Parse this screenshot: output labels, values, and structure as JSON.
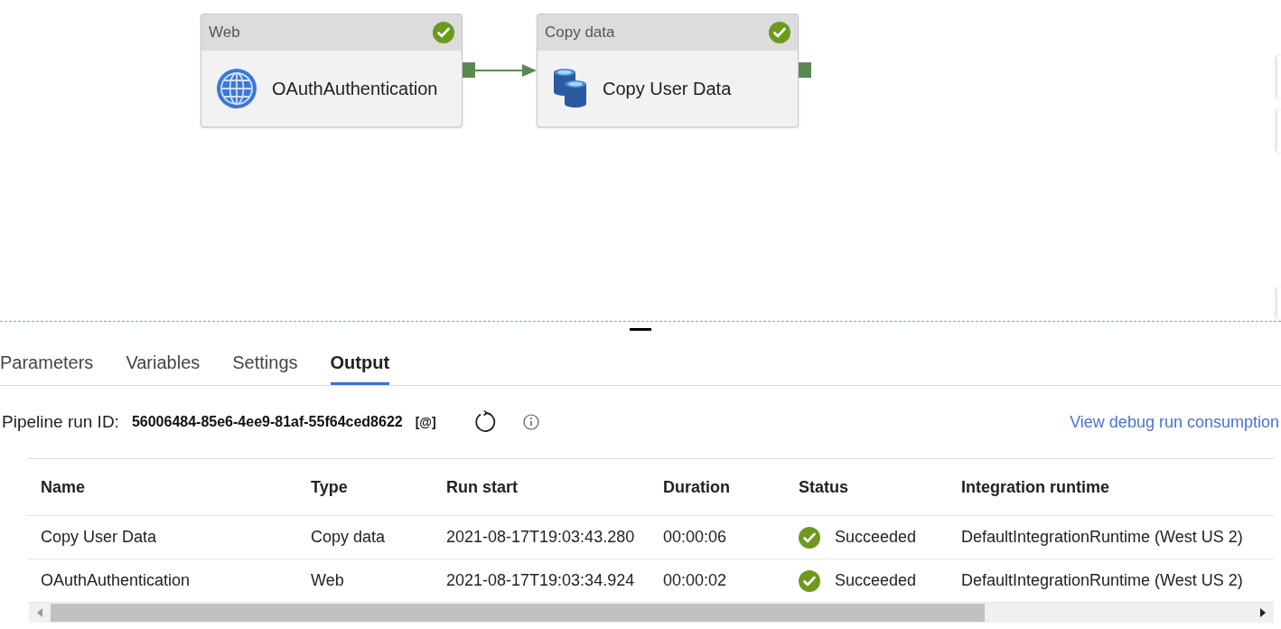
{
  "canvas": {
    "activities": [
      {
        "kind": "web",
        "type_label": "Web",
        "name": "OAuthAuthentication",
        "succeeded": true
      },
      {
        "kind": "copy",
        "type_label": "Copy data",
        "name": "Copy User Data",
        "succeeded": true
      }
    ]
  },
  "tabs": [
    {
      "label": "Parameters",
      "selected": false
    },
    {
      "label": "Variables",
      "selected": false
    },
    {
      "label": "Settings",
      "selected": false
    },
    {
      "label": "Output",
      "selected": true
    }
  ],
  "run": {
    "label": "Pipeline run ID:",
    "id": "56006484-85e6-4ee9-81af-55f64ced8622",
    "copy_glyph": "[@]",
    "link": "View debug run consumption"
  },
  "table": {
    "columns": [
      "Name",
      "Type",
      "Run start",
      "Duration",
      "Status",
      "Integration runtime"
    ],
    "rows": [
      {
        "name": "Copy User Data",
        "type": "Copy data",
        "run_start": "2021-08-17T19:03:43.280",
        "duration": "00:00:06",
        "status": "Succeeded",
        "succeeded": true,
        "runtime": "DefaultIntegrationRuntime (West US 2)"
      },
      {
        "name": "OAuthAuthentication",
        "type": "Web",
        "run_start": "2021-08-17T19:03:34.924",
        "duration": "00:00:02",
        "status": "Succeeded",
        "succeeded": true,
        "runtime": "DefaultIntegrationRuntime (West US 2)"
      }
    ]
  }
}
